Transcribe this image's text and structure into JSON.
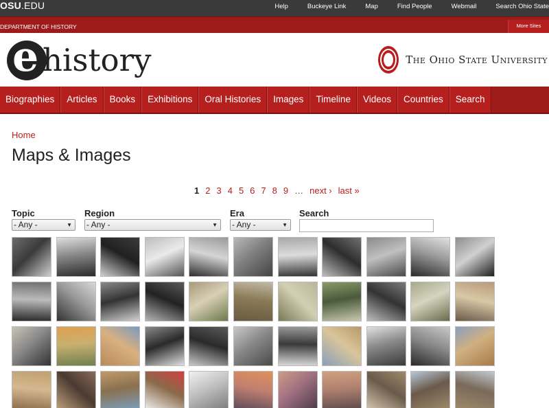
{
  "topbar": {
    "logo_bold": "OSU",
    "logo_rest": ".EDU",
    "links": [
      "Help",
      "Buckeye Link",
      "Map",
      "Find People",
      "Webmail",
      "Search Ohio State"
    ]
  },
  "dept": {
    "name": "DEPARTMENT OF HISTORY",
    "more_sites": "More Sites"
  },
  "header": {
    "logo_letter": "e",
    "logo_word": "history",
    "university": "The Ohio State University"
  },
  "nav": [
    "Biographies",
    "Articles",
    "Books",
    "Exhibitions",
    "Oral Histories",
    "Images",
    "Timeline",
    "Videos",
    "Countries",
    "Search"
  ],
  "breadcrumb": "Home",
  "page_title": "Maps & Images",
  "pager": {
    "current": "1",
    "pages": [
      "2",
      "3",
      "4",
      "5",
      "6",
      "7",
      "8",
      "9"
    ],
    "ellipsis": "…",
    "next": "next ›",
    "last": "last »"
  },
  "filters": {
    "topic": {
      "label": "Topic",
      "value": "- Any -"
    },
    "region": {
      "label": "Region",
      "value": "- Any -"
    },
    "era": {
      "label": "Era",
      "value": "- Any -"
    },
    "search": {
      "label": "Search",
      "placeholder": ""
    }
  },
  "thumbnails": [
    [
      "#6d6d6d",
      "#cfcfcf",
      "#3a3a3a"
    ],
    [
      "#dedede",
      "#2a2a2a",
      "#888"
    ],
    [
      "#3c3c3c",
      "#cfcfcf",
      "#202020"
    ],
    [
      "#bdbdbd",
      "#555",
      "#eaeaea"
    ],
    [
      "#9a9a9a",
      "#2e2e2e",
      "#d5d5d5"
    ],
    [
      "#b8b8b8",
      "#444",
      "#7f7f7f"
    ],
    [
      "#a8a8a8",
      "#333",
      "#dcdcdc"
    ],
    [
      "#707070",
      "#bdbdbd",
      "#2d2d2d"
    ],
    [
      "#8b8b8b",
      "#4a4a4a",
      "#c0c0c0"
    ],
    [
      "#e2e2e2",
      "#2a2a2a",
      "#9a9a9a"
    ],
    [
      "#8e8e8e",
      "#1f1f1f",
      "#d0d0d0"
    ],
    [
      "#707070",
      "#2a2a2a",
      "#bbb"
    ],
    [
      "#d8d8d8",
      "#333",
      "#999"
    ],
    [
      "#8a8a8a",
      "#d0d0d0",
      "#333"
    ],
    [
      "#5a5a5a",
      "#b5b5b5",
      "#222"
    ],
    [
      "#a89a7a",
      "#6a7a4a",
      "#d8cfb5"
    ],
    [
      "#c2b9a5",
      "#6a5a42",
      "#8a7a55"
    ],
    [
      "#b9b59a",
      "#7a7a55",
      "#d3cfb3"
    ],
    [
      "#8a9a6a",
      "#c8c8b0",
      "#4a5a3a"
    ],
    [
      "#7a7a7a",
      "#bdbdbd",
      "#333"
    ],
    [
      "#a8a88a",
      "#6a6a4a",
      "#d5d5c0"
    ],
    [
      "#b89a7a",
      "#6a5a4a",
      "#d9c7a5"
    ],
    [
      "#c7c3b5",
      "#333",
      "#888"
    ],
    [
      "#e0a050",
      "#708050",
      "#c8b070"
    ],
    [
      "#7a9ac0",
      "#b88a5a",
      "#d9b080"
    ],
    [
      "#8a8a8a",
      "#e0e0e0",
      "#2a2a2a"
    ],
    [
      "#5a5a5a",
      "#c8c8c8",
      "#2a2a2a"
    ],
    [
      "#c8c8c8",
      "#4a4a4a",
      "#888"
    ],
    [
      "#9a9a9a",
      "#d8d8d8",
      "#3a3a3a"
    ],
    [
      "#b89a6a",
      "#8aa0b8",
      "#d9c59a"
    ],
    [
      "#e0e0e0",
      "#3a3a3a",
      "#888"
    ],
    [
      "#c8c8c8",
      "#2a2a2a",
      "#8a8a8a"
    ],
    [
      "#8aa0c0",
      "#a87a4a",
      "#d0b080"
    ],
    [
      "#c0a070",
      "#8a6a4a",
      "#d5b890"
    ],
    [
      "#8a6a5a",
      "#c0a080",
      "#4a3a30"
    ],
    [
      "#c09a6a",
      "#7aa0c0",
      "#8a7050"
    ],
    [
      "#d04040",
      "#f0f0f0",
      "#8a6a4a"
    ],
    [
      "#f0f0f0",
      "#7a7a7a",
      "#c0c0c0"
    ],
    [
      "#e0905a",
      "#5a4a5a",
      "#c08070"
    ],
    [
      "#d09a8a",
      "#4a3a4a",
      "#a07080"
    ],
    [
      "#d0a080",
      "#5a4a4a",
      "#b08070"
    ],
    [
      "#a08a6a",
      "#d8c8b0",
      "#6a5a4a"
    ],
    [
      "#b8c8d8",
      "#a08a6a",
      "#6a5a4a"
    ],
    [
      "#c0c8d0",
      "#a08a6a",
      "#7a6a5a"
    ]
  ]
}
